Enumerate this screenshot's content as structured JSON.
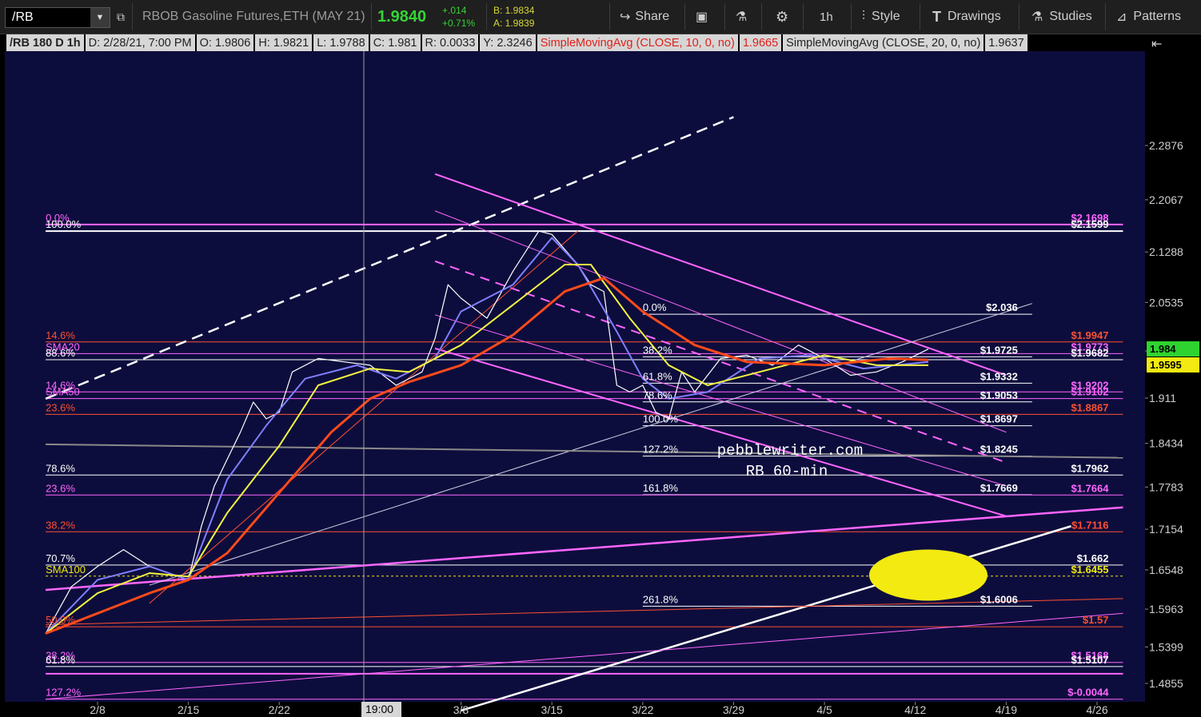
{
  "toolbar": {
    "symbol": "/RB",
    "description": "RBOB Gasoline Futures,ETH (MAY 21)",
    "last": "1.9840",
    "change": "+.014",
    "change_pct": "+0.71%",
    "bid": "B: 1.9834",
    "ask": "A: 1.9839",
    "share_label": "Share",
    "timeframe_label": "1h",
    "style_label": "Style",
    "drawings_label": "Drawings",
    "studies_label": "Studies",
    "patterns_label": "Patterns"
  },
  "infobar": {
    "title": "/RB 180 D 1h",
    "date": "D: 2/28/21, 7:00 PM",
    "open": "O: 1.9806",
    "high": "H: 1.9821",
    "low": "L: 1.9788",
    "close": "C: 1.981",
    "range": "R: 0.0033",
    "y": "Y: 2.3246",
    "sma10": "SimpleMovingAvg (CLOSE, 10, 0, no)",
    "sma10_value": "1.9665",
    "sma20": "SimpleMovingAvg (CLOSE, 20, 0, no)",
    "sma20_value": "1.9637"
  },
  "annotations": {
    "site": "pebblewriter.com",
    "caption": "RB 60-min",
    "crosshair_time": "19:00"
  },
  "chart_data": {
    "type": "line",
    "x_ticks": [
      "2/8",
      "2/15",
      "2/22",
      "3/1",
      "3/8",
      "3/15",
      "3/22",
      "3/29",
      "4/5",
      "4/12",
      "4/19",
      "4/26"
    ],
    "y_ticks": [
      "2.2876",
      "2.2067",
      "2.1288",
      "2.0535",
      "1.9811",
      "1.911",
      "1.8434",
      "1.7783",
      "1.7154",
      "1.6548",
      "1.5963",
      "1.5399",
      "1.4855"
    ],
    "ylim": [
      1.45,
      2.33
    ],
    "price_badges": [
      {
        "label": "1.984",
        "value": 1.984,
        "bg": "#2fd32f",
        "fg": "#000000"
      },
      {
        "label": "1.9595",
        "value": 1.9595,
        "bg": "#f2ea10",
        "fg": "#000000"
      }
    ],
    "series": [
      {
        "name": "Price",
        "color": "#ffffff",
        "points": [
          [
            "2/4",
            1.56
          ],
          [
            "2/6",
            1.63
          ],
          [
            "2/8",
            1.66
          ],
          [
            "2/10",
            1.685
          ],
          [
            "2/12",
            1.66
          ],
          [
            "2/15",
            1.64
          ],
          [
            "2/16",
            1.72
          ],
          [
            "2/17",
            1.78
          ],
          [
            "2/18",
            1.82
          ],
          [
            "2/19",
            1.86
          ],
          [
            "2/20",
            1.905
          ],
          [
            "2/21",
            1.88
          ],
          [
            "2/22",
            1.89
          ],
          [
            "2/23",
            1.95
          ],
          [
            "2/25",
            1.97
          ],
          [
            "2/27",
            1.965
          ],
          [
            "3/1",
            1.96
          ],
          [
            "3/3",
            1.93
          ],
          [
            "3/5",
            1.95
          ],
          [
            "3/6",
            2.0
          ],
          [
            "3/7",
            2.08
          ],
          [
            "3/8",
            2.06
          ],
          [
            "3/10",
            2.03
          ],
          [
            "3/12",
            2.1
          ],
          [
            "3/14",
            2.16
          ],
          [
            "3/15",
            2.155
          ],
          [
            "3/17",
            2.11
          ],
          [
            "3/18",
            2.08
          ],
          [
            "3/19",
            2.07
          ],
          [
            "3/20",
            1.93
          ],
          [
            "3/21",
            1.92
          ],
          [
            "3/22",
            1.93
          ],
          [
            "3/23",
            1.89
          ],
          [
            "3/24",
            1.88
          ],
          [
            "3/25",
            1.95
          ],
          [
            "3/26",
            1.92
          ],
          [
            "3/28",
            1.97
          ],
          [
            "3/30",
            1.975
          ],
          [
            "4/1",
            1.96
          ],
          [
            "4/3",
            1.99
          ],
          [
            "4/5",
            1.97
          ],
          [
            "4/7",
            1.945
          ],
          [
            "4/9",
            1.95
          ],
          [
            "4/11",
            1.965
          ],
          [
            "4/13",
            1.984
          ]
        ]
      },
      {
        "name": "SMA10",
        "color": "#7f7fff",
        "points": [
          [
            "2/4",
            1.56
          ],
          [
            "2/8",
            1.64
          ],
          [
            "2/12",
            1.66
          ],
          [
            "2/15",
            1.64
          ],
          [
            "2/18",
            1.79
          ],
          [
            "2/21",
            1.87
          ],
          [
            "2/24",
            1.94
          ],
          [
            "2/28",
            1.96
          ],
          [
            "3/3",
            1.94
          ],
          [
            "3/6",
            1.97
          ],
          [
            "3/8",
            2.04
          ],
          [
            "3/12",
            2.08
          ],
          [
            "3/15",
            2.15
          ],
          [
            "3/17",
            2.11
          ],
          [
            "3/20",
            2.01
          ],
          [
            "3/22",
            1.94
          ],
          [
            "3/24",
            1.91
          ],
          [
            "3/27",
            1.92
          ],
          [
            "3/31",
            1.97
          ],
          [
            "4/4",
            1.975
          ],
          [
            "4/8",
            1.955
          ],
          [
            "4/13",
            1.965
          ]
        ]
      },
      {
        "name": "SMA20",
        "color": "#f5f542",
        "points": [
          [
            "2/4",
            1.56
          ],
          [
            "2/8",
            1.62
          ],
          [
            "2/12",
            1.65
          ],
          [
            "2/15",
            1.645
          ],
          [
            "2/18",
            1.74
          ],
          [
            "2/22",
            1.84
          ],
          [
            "2/25",
            1.93
          ],
          [
            "3/1",
            1.955
          ],
          [
            "3/4",
            1.95
          ],
          [
            "3/8",
            1.99
          ],
          [
            "3/12",
            2.05
          ],
          [
            "3/16",
            2.11
          ],
          [
            "3/18",
            2.11
          ],
          [
            "3/21",
            2.03
          ],
          [
            "3/24",
            1.96
          ],
          [
            "3/27",
            1.93
          ],
          [
            "3/31",
            1.95
          ],
          [
            "4/5",
            1.975
          ],
          [
            "4/9",
            1.96
          ],
          [
            "4/13",
            1.96
          ]
        ]
      },
      {
        "name": "SMA50",
        "color": "#ff4a1a",
        "points": [
          [
            "2/4",
            1.56
          ],
          [
            "2/8",
            1.59
          ],
          [
            "2/12",
            1.62
          ],
          [
            "2/15",
            1.64
          ],
          [
            "2/18",
            1.68
          ],
          [
            "2/22",
            1.77
          ],
          [
            "2/26",
            1.86
          ],
          [
            "3/1",
            1.91
          ],
          [
            "3/4",
            1.935
          ],
          [
            "3/8",
            1.96
          ],
          [
            "3/12",
            2.005
          ],
          [
            "3/16",
            2.07
          ],
          [
            "3/19",
            2.09
          ],
          [
            "3/22",
            2.04
          ],
          [
            "3/26",
            1.99
          ],
          [
            "3/30",
            1.965
          ],
          [
            "4/5",
            1.96
          ],
          [
            "4/10",
            1.97
          ],
          [
            "4/13",
            1.968
          ]
        ]
      }
    ],
    "levels": [
      {
        "value": 2.1698,
        "color": "#ff66ff",
        "left_label": "0.0%",
        "right_label": "$2.1698",
        "x_start": "2/4",
        "x_end": "4/28",
        "width": 2
      },
      {
        "value": 2.1599,
        "color": "#ffffff",
        "left_label": "100.0%",
        "right_label": "$2.1599",
        "x_start": "2/4",
        "x_end": "4/28",
        "width": 2
      },
      {
        "value": 2.036,
        "color": "#ffffff",
        "left_label": "0.0%",
        "right_label": "$2.036",
        "x_start": "3/22",
        "x_end": "4/21",
        "width": 1
      },
      {
        "value": 1.9947,
        "color": "#ff5030",
        "left_label": "14.6%",
        "right_label": "$1.9947",
        "x_start": "2/4",
        "x_end": "4/28",
        "width": 1
      },
      {
        "value": 1.9773,
        "color": "#ff66ff",
        "left_label": "SMA20",
        "right_label": "$1.9773",
        "x_start": "2/4",
        "x_end": "4/28",
        "width": 1
      },
      {
        "value": 1.9725,
        "color": "#ffffff",
        "left_label": "38.2%",
        "right_label": "$1.9725",
        "x_start": "3/22",
        "x_end": "4/21",
        "width": 1
      },
      {
        "value": 1.9682,
        "color": "#ffffff",
        "left_label": "88.6%",
        "right_label": "$1.9682",
        "x_start": "2/4",
        "x_end": "4/28",
        "width": 1
      },
      {
        "value": 1.9332,
        "color": "#ffffff",
        "left_label": "61.8%",
        "right_label": "$1.9332",
        "x_start": "3/22",
        "x_end": "4/21",
        "width": 1
      },
      {
        "value": 1.9202,
        "color": "#ff66ff",
        "left_label": "14.6%",
        "right_label": "$1.9202",
        "x_start": "2/4",
        "x_end": "4/28",
        "width": 1
      },
      {
        "value": 1.9102,
        "color": "#ff66ff",
        "left_label": "SMA50",
        "right_label": "$1.9102",
        "x_start": "2/4",
        "x_end": "4/28",
        "width": 1
      },
      {
        "value": 1.9053,
        "color": "#ffffff",
        "left_label": "78.6%",
        "right_label": "$1.9053",
        "x_start": "3/22",
        "x_end": "4/21",
        "width": 1
      },
      {
        "value": 1.8867,
        "color": "#ff5030",
        "left_label": "23.6%",
        "right_label": "$1.8867",
        "x_start": "2/4",
        "x_end": "4/28",
        "width": 1
      },
      {
        "value": 1.8697,
        "color": "#ffffff",
        "left_label": "100.0%",
        "right_label": "$1.8697",
        "x_start": "3/22",
        "x_end": "4/21",
        "width": 1
      },
      {
        "value": 1.8245,
        "color": "#ffffff",
        "left_label": "127.2%",
        "right_label": "$1.8245",
        "x_start": "3/22",
        "x_end": "4/21",
        "width": 1
      },
      {
        "value": 1.7962,
        "color": "#ffffff",
        "left_label": "78.6%",
        "right_label": "$1.7962",
        "x_start": "2/4",
        "x_end": "4/28",
        "width": 1
      },
      {
        "value": 1.7669,
        "color": "#ffffff",
        "left_label": "161.8%",
        "right_label": "$1.7669",
        "x_start": "3/22",
        "x_end": "4/21",
        "width": 1
      },
      {
        "value": 1.7664,
        "color": "#ff66ff",
        "left_label": "23.6%",
        "right_label": "$1.7664",
        "x_start": "2/4",
        "x_end": "4/28",
        "width": 1
      },
      {
        "value": 1.7116,
        "color": "#ff5030",
        "left_label": "38.2%",
        "right_label": "$1.7116",
        "x_start": "2/4",
        "x_end": "4/28",
        "width": 1
      },
      {
        "value": 1.662,
        "color": "#ffffff",
        "left_label": "70.7%",
        "right_label": "$1.662",
        "x_start": "2/4",
        "x_end": "4/28",
        "width": 1
      },
      {
        "value": 1.6455,
        "color": "#f2ea10",
        "left_label": "SMA100",
        "right_label": "$1.6455",
        "x_start": "2/4",
        "x_end": "4/28",
        "width": 1,
        "dash": "3,3"
      },
      {
        "value": 1.6006,
        "color": "#ffffff",
        "left_label": "261.8%",
        "right_label": "$1.6006",
        "x_start": "3/22",
        "x_end": "4/21",
        "width": 1
      },
      {
        "value": 1.57,
        "color": "#ff5030",
        "left_label": "50.0%",
        "right_label": "$1.57",
        "x_start": "2/4",
        "x_end": "4/28",
        "width": 1
      },
      {
        "value": 1.5168,
        "color": "#ff66ff",
        "left_label": "38.2%",
        "right_label": "$1.5168",
        "x_start": "2/4",
        "x_end": "4/28",
        "width": 1
      },
      {
        "value": 1.5107,
        "color": "#ffffff",
        "left_label": "61.8%",
        "right_label": "$1.5107",
        "x_start": "2/4",
        "x_end": "4/28",
        "width": 1
      },
      {
        "value": 1.5,
        "color": "#ff66ff",
        "left_label": "",
        "right_label": "",
        "x_start": "2/4",
        "x_end": "4/28",
        "width": 2
      },
      {
        "value": 1.462,
        "color": "#ff66ff",
        "left_label": "127.2%",
        "right_label": "$-0.0044",
        "x_start": "2/4",
        "x_end": "4/28",
        "width": 1
      }
    ],
    "trendlines": [
      {
        "from": [
          "2/4",
          1.91
        ],
        "to": [
          "3/29",
          2.33
        ],
        "color": "#ffffff",
        "width": 2.5,
        "dash": "14,8"
      },
      {
        "from": [
          "3/6",
          2.245
        ],
        "to": [
          "4/19",
          1.945
        ],
        "color": "#ff66ff",
        "width": 2
      },
      {
        "from": [
          "3/6",
          2.19
        ],
        "to": [
          "4/19",
          1.86
        ],
        "color": "#ff66ff",
        "width": 1
      },
      {
        "from": [
          "3/6",
          2.115
        ],
        "to": [
          "4/19",
          1.815
        ],
        "color": "#ff66ff",
        "width": 2,
        "dash": "12,8"
      },
      {
        "from": [
          "3/6",
          2.035
        ],
        "to": [
          "4/19",
          1.78
        ],
        "color": "#ff66ff",
        "width": 1
      },
      {
        "from": [
          "3/6",
          1.985
        ],
        "to": [
          "4/19",
          1.735
        ],
        "color": "#ff66ff",
        "width": 2
      },
      {
        "from": [
          "2/4",
          1.625
        ],
        "to": [
          "4/28",
          1.748
        ],
        "color": "#ff66ff",
        "width": 2.5
      },
      {
        "from": [
          "3/8",
          1.445
        ],
        "to": [
          "4/24",
          1.72
        ],
        "color": "#ffffff",
        "width": 2.5
      },
      {
        "from": [
          "2/12",
          1.632
        ],
        "to": [
          "4/21",
          2.052
        ],
        "color": "#cfcfe8",
        "width": 1
      },
      {
        "from": [
          "2/4",
          1.842
        ],
        "to": [
          "4/28",
          1.822
        ],
        "color": "#8a8a8a",
        "width": 2
      },
      {
        "from": [
          "2/4",
          1.573
        ],
        "to": [
          "4/28",
          1.612
        ],
        "color": "#ff5030",
        "width": 1
      },
      {
        "from": [
          "2/4",
          1.462
        ],
        "to": [
          "4/28",
          1.59
        ],
        "color": "#ff66ff",
        "width": 1
      },
      {
        "from": [
          "2/12",
          1.605
        ],
        "to": [
          "3/17",
          2.16
        ],
        "color": "#ff5030",
        "width": 1
      }
    ],
    "highlight": {
      "center": [
        "4/13",
        1.647
      ],
      "rx": 74,
      "ry": 32,
      "color": "#f2ea10"
    }
  }
}
